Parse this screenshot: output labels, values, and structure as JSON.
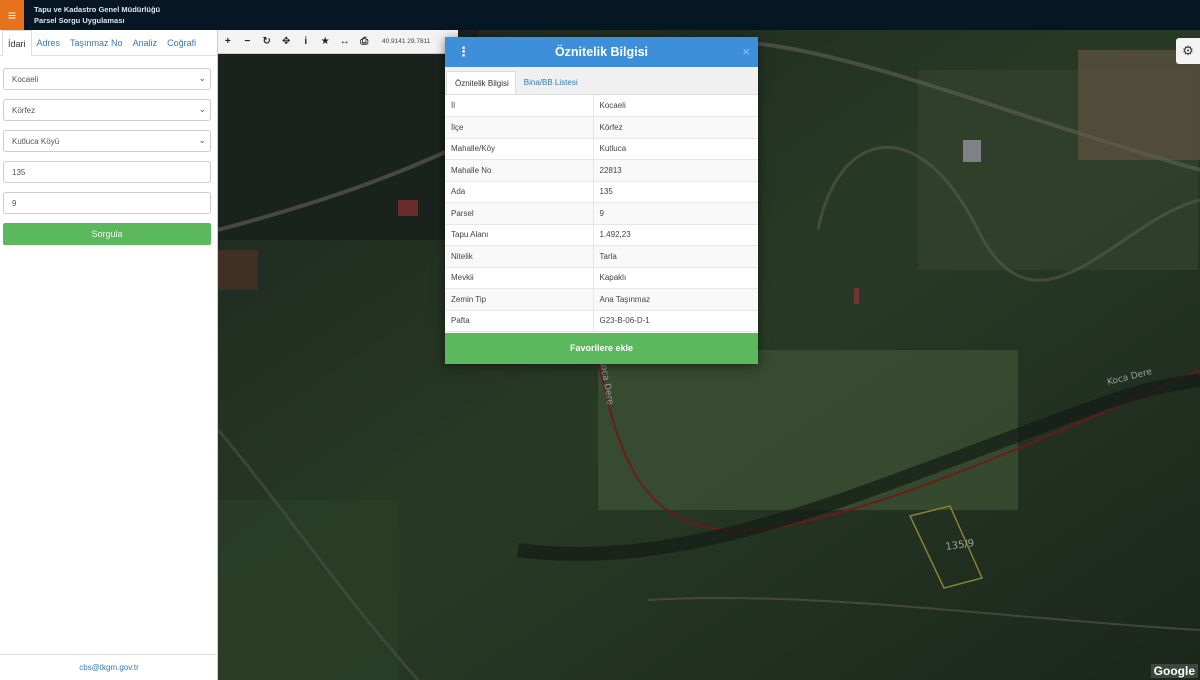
{
  "header": {
    "menu_icon": "hamburger-icon",
    "title_line1": "Tapu ve Kadastro Genel Müdürlüğü",
    "title_line2": "Parsel Sorgu Uygulaması",
    "accent_color": "#e8721c"
  },
  "sidebar": {
    "tabs": [
      {
        "label": "İdari",
        "active": true
      },
      {
        "label": "Adres",
        "active": false
      },
      {
        "label": "Taşınmaz No",
        "active": false
      },
      {
        "label": "Analiz",
        "active": false
      },
      {
        "label": "Coğrafi",
        "active": false
      }
    ],
    "il_select": "Kocaeli",
    "ilce_select": "Körfez",
    "mahalle_select": "Kutluca Köyü",
    "ada_value": "135",
    "parsel_value": "9",
    "query_button": "Sorgula",
    "footer_email": "cbs@tkgm.gov.tr"
  },
  "map": {
    "tools": [
      "zoom-in-icon",
      "zoom-out-icon",
      "refresh-icon",
      "locate-icon",
      "info-icon",
      "star-icon",
      "measure-icon",
      "print-icon"
    ],
    "coordinates": "40.9141   29.7811",
    "parcel_label": "135/9",
    "stream_label_1": "Koca Dere",
    "stream_label_2": "Koca Dere",
    "attribution": "Google"
  },
  "dialog": {
    "title": "Öznitelik Bilgisi",
    "close": "×",
    "tabs": [
      {
        "label": "Öznitelik Bilgisi",
        "active": true
      },
      {
        "label": "Bina/BB Listesi",
        "active": false
      }
    ],
    "rows": [
      {
        "key": "İl",
        "value": "Kocaeli"
      },
      {
        "key": "İlçe",
        "value": "Körfez"
      },
      {
        "key": "Mahalle/Köy",
        "value": "Kutluca"
      },
      {
        "key": "Mahalle No",
        "value": "22813"
      },
      {
        "key": "Ada",
        "value": "135"
      },
      {
        "key": "Parsel",
        "value": "9"
      },
      {
        "key": "Tapu Alanı",
        "value": "1.492,23"
      },
      {
        "key": "Nitelik",
        "value": "Tarla"
      },
      {
        "key": "Mevkii",
        "value": "Kapaklı"
      },
      {
        "key": "Zemin Tip",
        "value": "Ana Taşınmaz"
      },
      {
        "key": "Pafta",
        "value": "G23-B-06-D-1"
      }
    ],
    "favorite_button": "Favorilere ekle",
    "header_color": "#3c8fd8",
    "button_color": "#5cb85c"
  }
}
